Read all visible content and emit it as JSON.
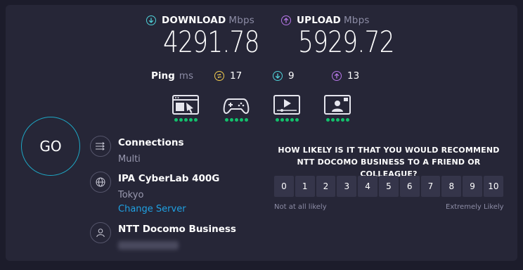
{
  "download": {
    "label": "DOWNLOAD",
    "unit": "Mbps",
    "value": "4291.78",
    "icon": "arrow-down-circle-icon",
    "color": "#4fd1d9"
  },
  "upload": {
    "label": "UPLOAD",
    "unit": "Mbps",
    "value": "5929.72",
    "icon": "arrow-up-circle-icon",
    "color": "#b777e8"
  },
  "ping": {
    "label": "Ping",
    "unit": "ms",
    "idle": "17",
    "download": "9",
    "upload": "13",
    "idle_color": "#f2cc4f",
    "download_color": "#4fd1d9",
    "upload_color": "#b777e8"
  },
  "use_cases": [
    {
      "icon": "web-browsing-icon",
      "rating": 5
    },
    {
      "icon": "gaming-controller-icon",
      "rating": 5
    },
    {
      "icon": "video-streaming-icon",
      "rating": 5
    },
    {
      "icon": "video-call-icon",
      "rating": 5
    }
  ],
  "go_button": {
    "label": "GO"
  },
  "connections": {
    "title": "Connections",
    "value": "Multi",
    "icon": "connections-arrows-icon"
  },
  "server": {
    "title": "IPA CyberLab 400G",
    "location": "Tokyo",
    "change_link": "Change Server",
    "icon": "globe-icon"
  },
  "provider": {
    "title": "NTT Docomo Business",
    "icon": "user-icon"
  },
  "survey": {
    "question": "HOW LIKELY IS IT THAT YOU WOULD RECOMMEND NTT DOCOMO BUSINESS TO A FRIEND OR COLLEAGUE?",
    "options": [
      "0",
      "1",
      "2",
      "3",
      "4",
      "5",
      "6",
      "7",
      "8",
      "9",
      "10"
    ],
    "low_label": "Not at all likely",
    "high_label": "Extremely Likely"
  }
}
